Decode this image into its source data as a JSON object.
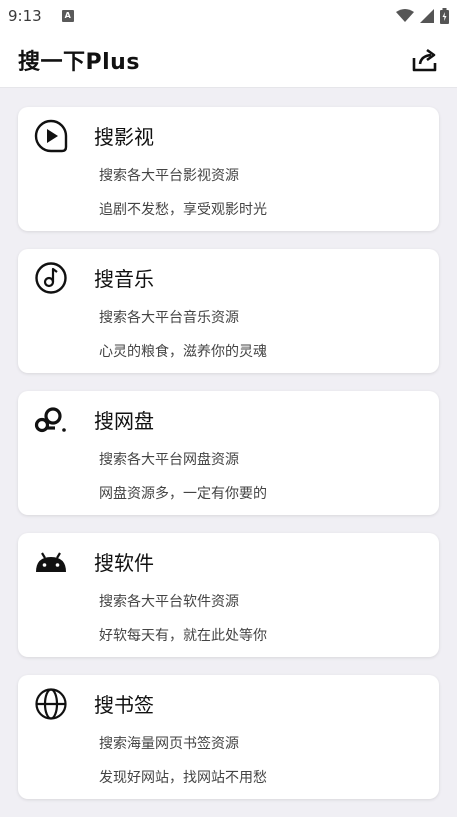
{
  "status_bar": {
    "time": "9:13",
    "notification_icon": "a-notification-icon",
    "icons": [
      "wifi-icon",
      "signal-icon",
      "battery-icon"
    ]
  },
  "app_bar": {
    "title": "搜一下Plus",
    "share_icon": "share-icon"
  },
  "cards": [
    {
      "icon": "play-circle-icon",
      "title": "搜影视",
      "subtitle": "搜索各大平台影视资源",
      "tagline": "追剧不发愁，享受观影时光"
    },
    {
      "icon": "music-icon",
      "title": "搜音乐",
      "subtitle": "搜索各大平台音乐资源",
      "tagline": "心灵的粮食，滋养你的灵魂"
    },
    {
      "icon": "cloud-drive-icon",
      "title": "搜网盘",
      "subtitle": "搜索各大平台网盘资源",
      "tagline": "网盘资源多，一定有你要的"
    },
    {
      "icon": "android-icon",
      "title": "搜软件",
      "subtitle": "搜索各大平台软件资源",
      "tagline": "好软每天有，就在此处等你"
    },
    {
      "icon": "globe-icon",
      "title": "搜书签",
      "subtitle": "搜索海量网页书签资源",
      "tagline": "发现好网站，找网站不用愁"
    }
  ],
  "colors": {
    "background": "#f0eff4",
    "card": "#ffffff",
    "text": "#111111"
  }
}
